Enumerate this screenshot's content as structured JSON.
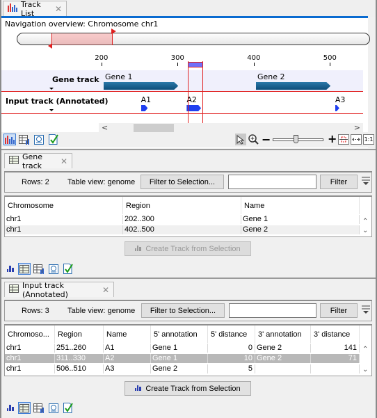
{
  "track_list": {
    "tab_label": "Track List",
    "nav_title": "Navigation overview: Chromosome chr1",
    "ruler": [
      {
        "label": "200",
        "pos": 200
      },
      {
        "label": "300",
        "pos": 300
      },
      {
        "label": "400",
        "pos": 400
      },
      {
        "label": "500",
        "pos": 500
      }
    ],
    "tracks": [
      {
        "name": "Gene track",
        "features": [
          {
            "label": "Gene 1",
            "start": 202,
            "end": 300
          },
          {
            "label": "Gene 2",
            "start": 402,
            "end": 500
          }
        ]
      },
      {
        "name": "Input track (Annotated)",
        "features": [
          {
            "label": "A1",
            "start": 251,
            "end": 260
          },
          {
            "label": "A2",
            "start": 311,
            "end": 330
          },
          {
            "label": "A3",
            "start": 506,
            "end": 510
          }
        ]
      }
    ],
    "selection": {
      "start": 311,
      "end": 330
    },
    "scroll_left": "<",
    "scroll_right": ">",
    "zoom_minus": "−",
    "zoom_plus": "+",
    "zoom_level_fraction": 0.45,
    "one_to_one": "1:1",
    "colors": {
      "selection": "#e02020",
      "gene": "#0d4d7a",
      "annotation": "#1f3ff0",
      "accent": "#0a6bd0"
    }
  },
  "gene_track": {
    "tab_label": "Gene track",
    "rows_label": "Rows: 2",
    "table_view_label": "Table view: genome",
    "filter_to_selection": "Filter to Selection...",
    "filter_input_value": "",
    "filter_button": "Filter",
    "columns": [
      "Chromosome",
      "Region",
      "Name"
    ],
    "rows": [
      [
        "chr1",
        "202..300",
        "Gene 1"
      ],
      [
        "chr1",
        "402..500",
        "Gene 2"
      ]
    ],
    "create_track": "Create Track from Selection",
    "create_track_enabled": false
  },
  "input_track": {
    "tab_label": "Input track (Annotated)",
    "rows_label": "Rows: 3",
    "table_view_label": "Table view: genome",
    "filter_to_selection": "Filter to Selection...",
    "filter_input_value": "",
    "filter_button": "Filter",
    "columns": [
      "Chromoso...",
      "Region",
      "Name",
      "5' annotation",
      "5' distance",
      "3' annotation",
      "3' distance"
    ],
    "rows": [
      [
        "chr1",
        "251..260",
        "A1",
        "Gene 1",
        "0",
        "Gene 2",
        "141"
      ],
      [
        "chr1",
        "311..330",
        "A2",
        "Gene 1",
        "10",
        "Gene 2",
        "71"
      ],
      [
        "chr1",
        "506..510",
        "A3",
        "Gene 2",
        "5",
        "",
        ""
      ]
    ],
    "selected_row": 1,
    "create_track": "Create Track from Selection",
    "create_track_enabled": true
  }
}
